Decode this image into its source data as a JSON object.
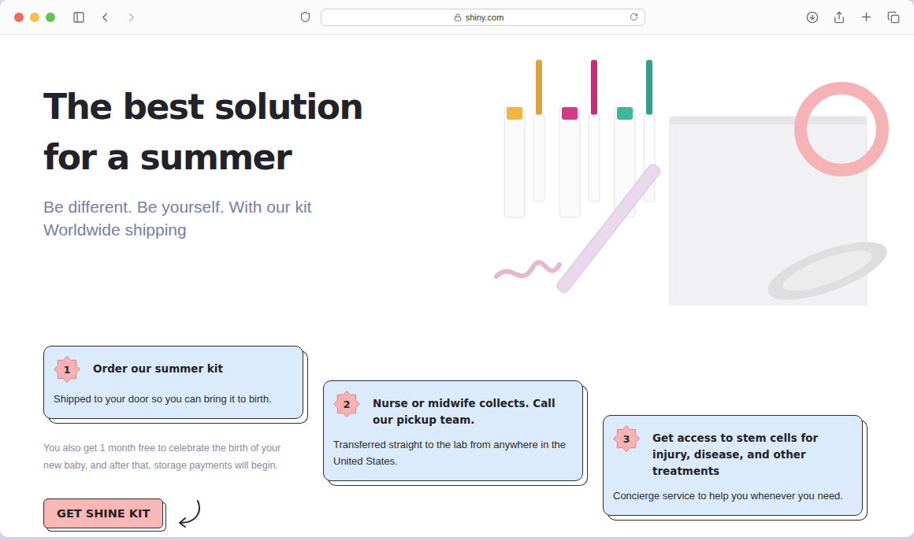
{
  "browser": {
    "url": "shiny.com"
  },
  "hero": {
    "title_lines": [
      "The best solution",
      "for a summer"
    ],
    "subtitle_lines": [
      "Be different. Be yourself. With our kit",
      "Worldwide shipping"
    ]
  },
  "steps": [
    {
      "number": "1",
      "title": "Order our summer kit",
      "body": "Shipped to your door so you can bring it to birth."
    },
    {
      "number": "2",
      "title": "Nurse or midwife collects. Call our pickup team.",
      "body": "Transferred straight to the lab from anywhere in the United States."
    },
    {
      "number": "3",
      "title": "Get access to stem cells for injury, disease, and other treatments",
      "body": "Concierge service to help you whenever you need."
    }
  ],
  "note": "You also get 1 month free to celebrate the birth of your new baby, and after that, storage payments will begin.",
  "cta": {
    "label": "GET SHINE KIT"
  }
}
